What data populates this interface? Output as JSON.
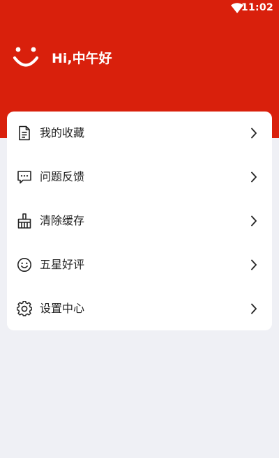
{
  "status_bar": {
    "time": "11:02",
    "wifi_icon": "wifi-icon"
  },
  "header": {
    "logo_icon": "smile-logo-icon",
    "greeting": "Hi,中午好",
    "color": "#d9200c"
  },
  "menu": {
    "items": [
      {
        "label": "我的收藏",
        "icon": "document-icon"
      },
      {
        "label": "问题反馈",
        "icon": "chat-bubble-icon"
      },
      {
        "label": "清除缓存",
        "icon": "broom-icon"
      },
      {
        "label": "五星好评",
        "icon": "smiley-face-icon"
      },
      {
        "label": "设置中心",
        "icon": "gear-icon"
      }
    ],
    "chevron_icon": "chevron-right-icon"
  }
}
